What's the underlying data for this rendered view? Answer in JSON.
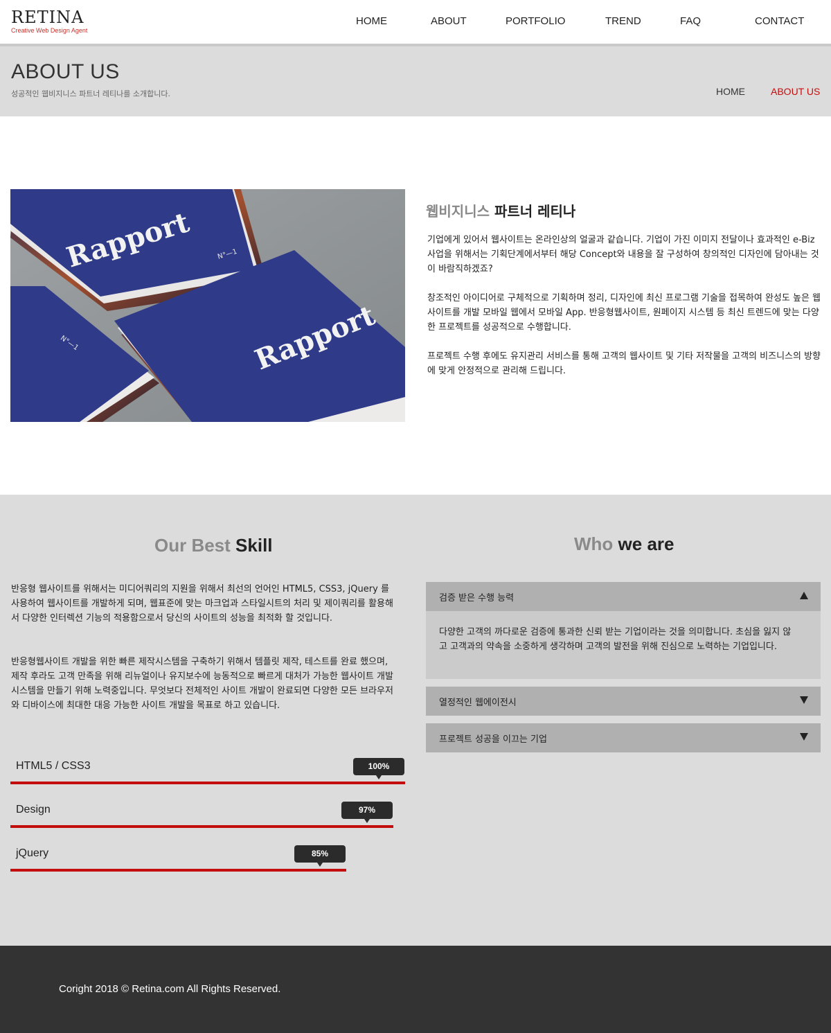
{
  "header": {
    "logo_title": "RETINA",
    "logo_sub": "Creative Web Design Agent",
    "nav": [
      "HOME",
      "ABOUT",
      "PORTFOLIO",
      "TREND",
      "FAQ",
      "CONTACT"
    ]
  },
  "title_band": {
    "title": "ABOUT US",
    "subtitle": "성공적인 웹비지니스 파트너 레티나를 소개합니다.",
    "breadcrumb_home": "HOME",
    "breadcrumb_current": "ABOUT US"
  },
  "intro": {
    "image_text": [
      "Rapport",
      "Rapport",
      "N°—1",
      "N°—1"
    ],
    "heading_light": "웹비지니스",
    "heading_dark": "파트너 레티나",
    "paragraphs": [
      "기업에게 있어서 웹사이트는 온라인상의 얼굴과 같습니다. 기업이 가진 이미지 전달이나 효과적인 e-Biz사업을 위해서는 기획단계에서부터 해당 Concept와 내용을 잘 구성하여 창의적인 디자인에 담아내는 것이 바람직하겠죠?",
      "창조적인 아이디어로 구체적으로 기획하며 정리, 디자인에 최신 프로그램 기술을 접목하여 완성도 높은 웹사이트를 개발 모바일 웹에서 모바일 App. 반응형웹사이트, 원페이지 시스템 등 최신 트렌드에 맞는 다양한 프로젝트를 성공적으로 수행합니다.",
      "프로젝트 수행 후에도 유지관리 서비스를 통해 고객의 웹사이트 및 기타 저작물을 고객의 비즈니스의 방향에 맞게 안정적으로 관리해 드립니다."
    ]
  },
  "skills": {
    "title_light": "Our Best",
    "title_dark": "Skill",
    "paragraphs": [
      "반응형 웹사이트를 위해서는 미디어쿼리의 지원을 위해서 최선의 언어인 HTML5, CSS3, jQuery 를 사용하여 웹사이트를 개발하게 되며, 웹표준에 맞는 마크업과 스타일시트의 처리 및 제이쿼리를 활용해서 다양한 인터렉션 기능의 적용함으로서 당신의 사이트의 성능을 최적화 할 것입니다.",
      "반응형웹사이트 개발을 위한 빠른 제작시스템을 구축하기 위해서 템플릿 제작, 테스트를 완료 했으며, 제작 후라도 고객 만족을 위해 리뉴얼이나 유지보수에 능동적으로 빠르게 대처가 가능한 웹사이트 개발시스템을 만들기 위해 노력중입니다. 무엇보다 전체적인 사이트 개발이 완료되면 다양한 모든 브라우저와 디바이스에 최대한 대응 가능한 사이트 개발을 목표로 하고 있습니다."
    ],
    "items": [
      {
        "name": "HTML5 / CSS3",
        "label": "100%",
        "value": 1.0
      },
      {
        "name": "Design",
        "label": "97%",
        "value": 0.97
      },
      {
        "name": "jQuery",
        "label": "85%",
        "value": 0.85
      }
    ]
  },
  "who": {
    "title_light": "Who",
    "title_dark": "we are",
    "accordion": [
      {
        "label": "검증 받은 수행 능력",
        "expanded": true,
        "body": "다양한 고객의 까다로운 검증에 통과한 신뢰 받는 기업이라는 것을 의미합니다. 초심을 잃지 않고 고객과의 약속을 소중하게 생각하며 고객의 발전을 위해 진심으로 노력하는 기업입니다."
      },
      {
        "label": "열정적인 웹에이전시",
        "expanded": false
      },
      {
        "label": "프로젝트 성공을 이끄는 기업",
        "expanded": false
      }
    ]
  },
  "footer": {
    "copyright": "Coright 2018 © Retina.com All Rights Reserved."
  },
  "colors": {
    "accent_red": "#c40d0d",
    "band_gray": "#dcdcdc",
    "footer_dark": "#333333"
  }
}
